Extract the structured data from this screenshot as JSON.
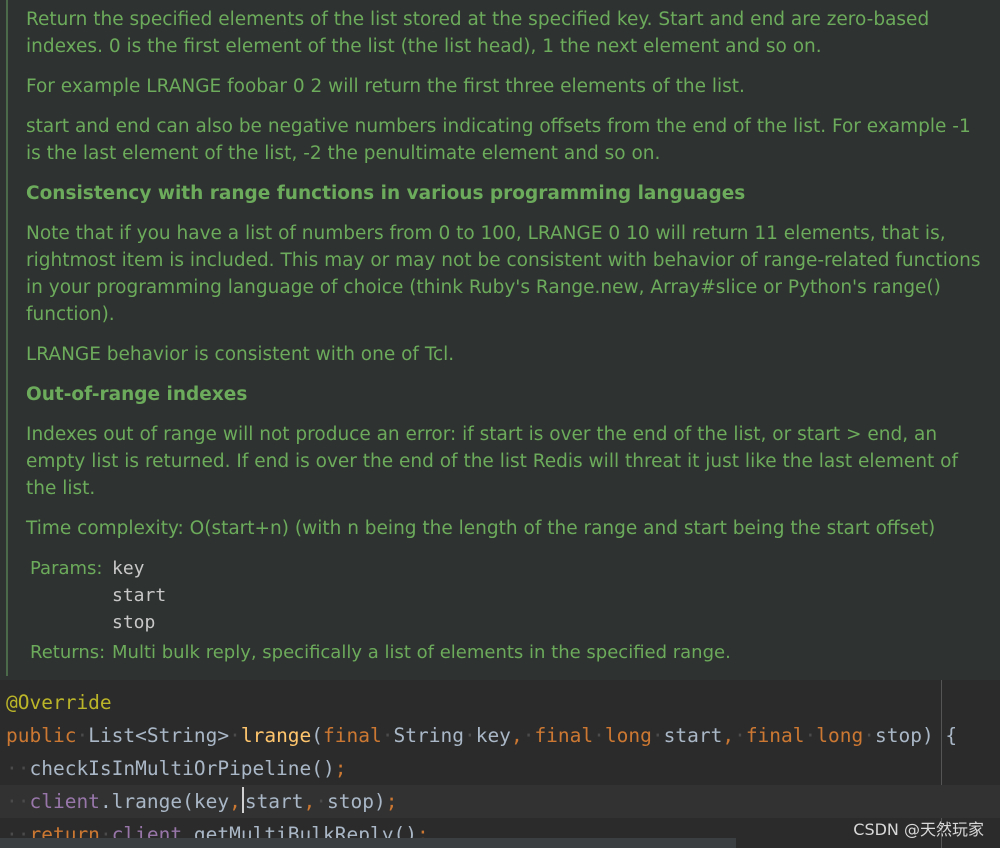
{
  "doc": {
    "para1": "Return the specified elements of the list stored at the specified key. Start and end are zero-based indexes. 0 is the first element of the list (the list head), 1 the next element and so on.",
    "para2": "For example LRANGE foobar 0 2 will return the first three elements of the list.",
    "para3": "start and end can also be negative numbers indicating offsets from the end of the list. For example -1 is the last element of the list, -2 the penultimate element and so on.",
    "heading1": "Consistency with range functions in various programming languages",
    "para4": "Note that if you have a list of numbers from 0 to 100, LRANGE 0 10 will return 11 elements, that is, rightmost item is included. This may or may not be consistent with behavior of range-related functions in your programming language of choice (think Ruby's Range.new, Array#slice or Python's range() function).",
    "para5": "LRANGE behavior is consistent with one of Tcl.",
    "heading2": "Out-of-range indexes",
    "para6": "Indexes out of range will not produce an error: if start is over the end of the list, or start > end, an empty list is returned. If end is over the end of the list Redis will threat it just like the last element of the list.",
    "para7": "Time complexity: O(start+n) (with n being the length of the range and start being the start offset)",
    "params_label": "Params:",
    "params": [
      "key",
      "start",
      "stop"
    ],
    "returns_label": "Returns:",
    "returns_value": "Multi bulk reply, specifically a list of elements in the specified range."
  },
  "code": {
    "annotation": "@Override",
    "public": "public",
    "return_type": "List<String>",
    "method_name": "lrange",
    "open_paren": "(",
    "final": "final",
    "string_type": "String",
    "param_key": "key",
    "comma": ",",
    "long_type": "long",
    "param_start": "start",
    "param_stop": "stop",
    "close_brace_open": ") {",
    "check_call": "checkIsInMultiOrPipeline()",
    "semicolon": ";",
    "client": "client",
    "lrange_call": ".lrange(key",
    "start_arg": "start",
    "stop_arg": "stop)",
    "return_kw": "return",
    "multibulk_call": ".getMultiBulkReply()"
  },
  "watermark": "CSDN @天然玩家",
  "colors": {
    "doc_text": "#6cab5b",
    "annotation": "#bbb529",
    "keyword": "#cc7832",
    "method": "#ffc66d",
    "field": "#9876aa",
    "plain": "#a9b7c6"
  }
}
